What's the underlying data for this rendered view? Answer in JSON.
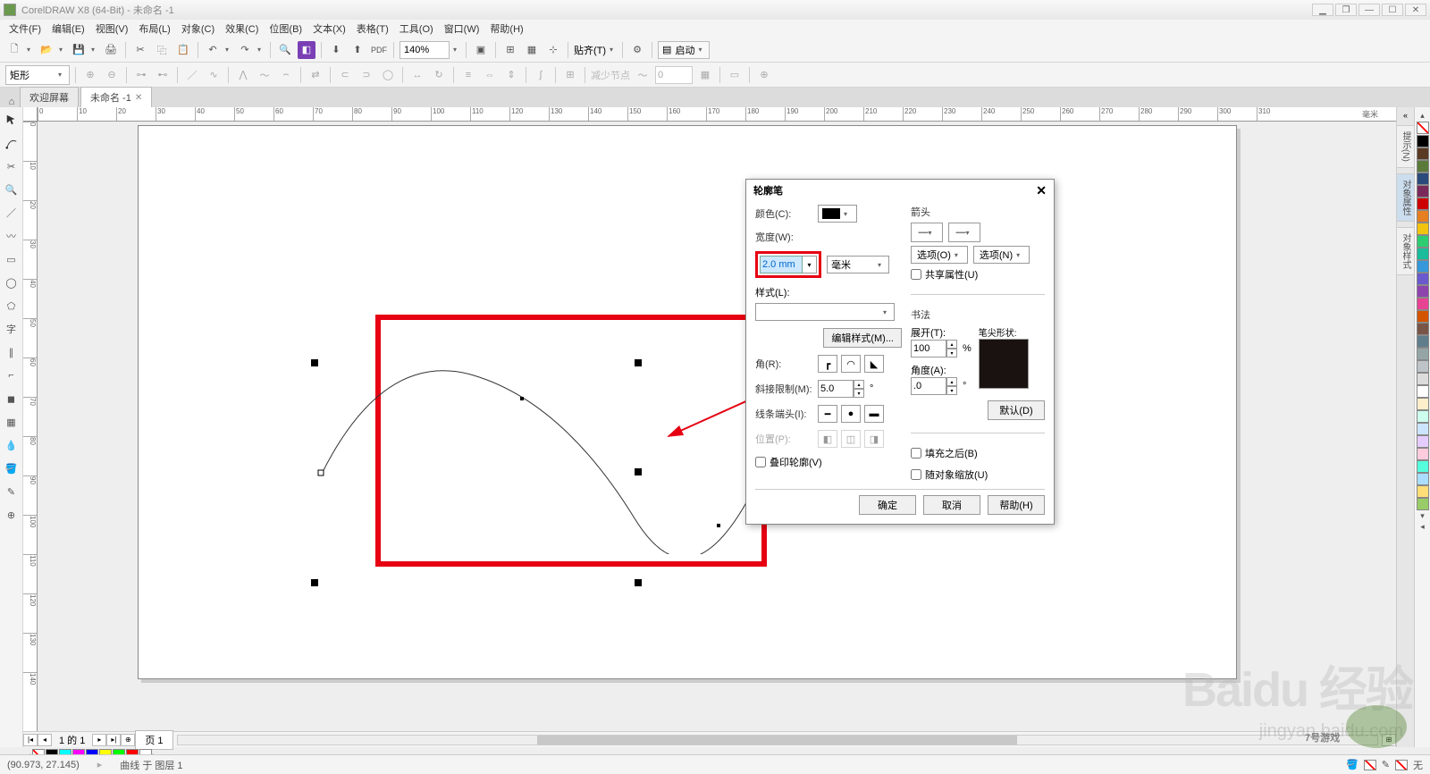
{
  "window": {
    "title": "CorelDRAW X8 (64-Bit) - 未命名 -1"
  },
  "menu": {
    "file": "文件(F)",
    "edit": "编辑(E)",
    "view": "视图(V)",
    "layout": "布局(L)",
    "object": "对象(C)",
    "effects": "效果(C)",
    "bitmaps": "位图(B)",
    "text": "文本(X)",
    "table": "表格(T)",
    "tools": "工具(O)",
    "window": "窗口(W)",
    "help": "帮助(H)"
  },
  "toolbar": {
    "zoom": "140%",
    "snap_label": "贴齐(T)",
    "launch": "启动"
  },
  "propbar": {
    "shape": "矩形",
    "reduce_nodes": "减少节点",
    "value0": "0"
  },
  "tabs": {
    "welcome": "欢迎屏幕",
    "doc1": "未命名 -1"
  },
  "ruler_h": [
    0,
    10,
    20,
    30,
    40,
    50,
    60,
    70,
    80,
    90,
    100,
    110,
    120,
    130,
    140,
    150,
    160,
    170,
    180,
    190,
    200,
    210,
    220,
    230,
    240,
    250,
    260,
    270,
    280,
    290,
    300,
    310
  ],
  "ruler_v": [
    0,
    10,
    20,
    30,
    40,
    50,
    60,
    70,
    80,
    90,
    100,
    110,
    120,
    130,
    140
  ],
  "ruler_unit": "毫米",
  "dialog": {
    "title": "轮廓笔",
    "color": "颜色(C):",
    "width": "宽度(W):",
    "width_value": "2.0 mm",
    "unit": "毫米",
    "style": "样式(L):",
    "edit_style": "编辑样式(M)...",
    "corners": "角(R):",
    "miter_limit": "斜接限制(M):",
    "miter_value": "5.0",
    "line_caps": "线条端头(I):",
    "position": "位置(P):",
    "overprint": "叠印轮廓(V)",
    "arrows": "箭头",
    "options_left": "选项(O)",
    "options_right": "选项(N)",
    "share_attrs": "共享属性(U)",
    "calligraphy": "书法",
    "stretch": "展开(T):",
    "stretch_value": "100",
    "percent": "%",
    "angle": "角度(A):",
    "angle_value": ".0",
    "degree": "°",
    "nib_shape": "笔尖形状:",
    "default": "默认(D)",
    "behind_fill": "填充之后(B)",
    "scale_with": "随对象缩放(U)",
    "ok": "确定",
    "cancel": "取消",
    "help": "帮助(H)"
  },
  "dockers": {
    "d1": "提示(N)",
    "d2": "对象属性",
    "d3": "对象样式"
  },
  "page_nav": {
    "count_text": "1 的 1",
    "page_tab": "页 1"
  },
  "status": {
    "coords": "(90.973, 27.145)",
    "selection": "曲线 于 图层 1",
    "none": "无"
  },
  "watermark": {
    "big": "Baidu 经验",
    "url": "jingyan.baidu.com",
    "game": "7号游戏"
  },
  "palette_colors": [
    "#000000",
    "#5a3a22",
    "#5b7a3a",
    "#2a4a7a",
    "#7a2a5a",
    "#c00",
    "#e67e22",
    "#f1c40f",
    "#2ecc71",
    "#1abc9c",
    "#3498db",
    "#6a5acd",
    "#8e44ad",
    "#e84393",
    "#d35400",
    "#795548",
    "#607d8b",
    "#95a5a6",
    "#bdc3c7",
    "#dcdcdc",
    "#ffffff",
    "#ffeecc",
    "#ccffee",
    "#cce5ff",
    "#e5ccff",
    "#ffccdd",
    "#5fd",
    "#adf",
    "#fd7",
    "#9c6"
  ],
  "mini_palette": [
    "#000",
    "#0ff",
    "#f0f",
    "#00f",
    "#ff0",
    "#0f0",
    "#f00",
    "#fff"
  ]
}
